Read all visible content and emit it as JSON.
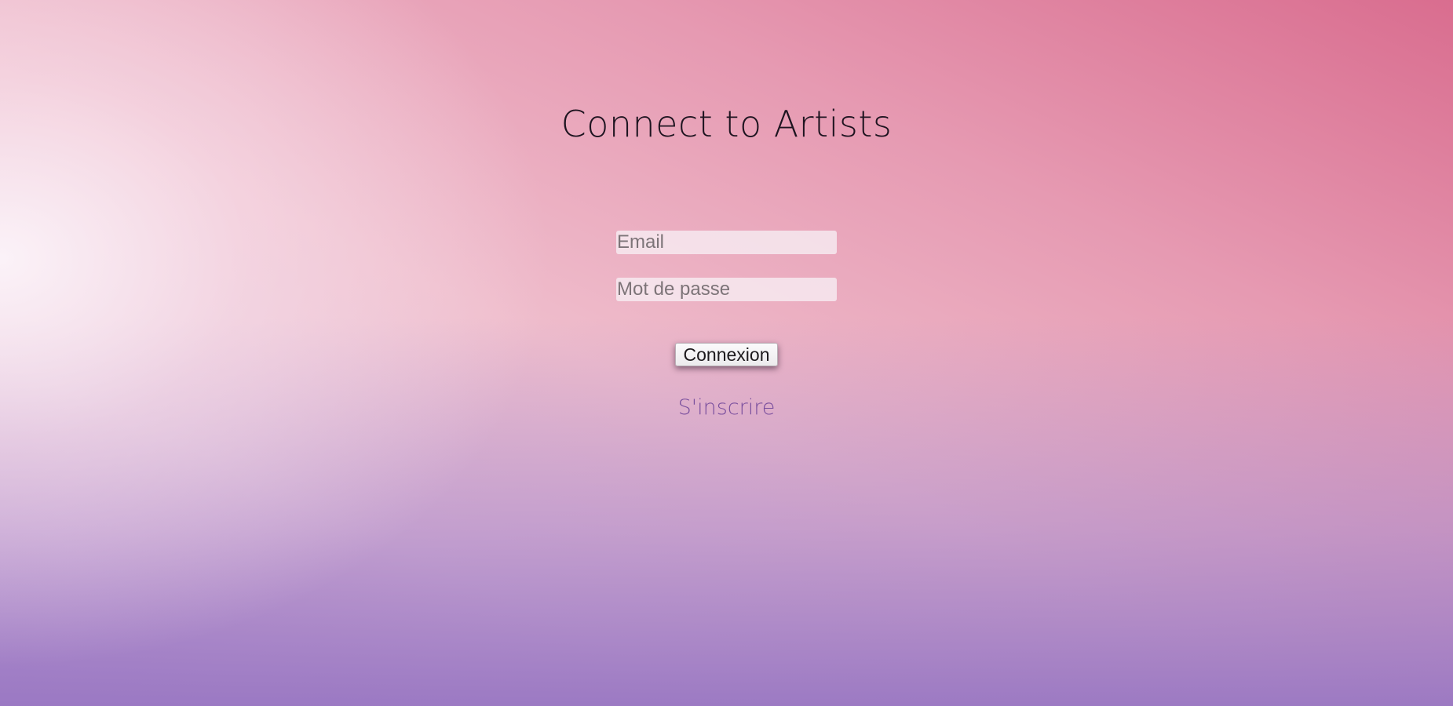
{
  "page": {
    "title": "Connect to Artists"
  },
  "login_form": {
    "email_placeholder": "Email",
    "email_value": "",
    "password_placeholder": "Mot de passe",
    "password_value": "",
    "submit_label": "Connexion",
    "signup_label": "S'inscrire"
  },
  "colors": {
    "gradient_top_right": "#d96d8f",
    "gradient_bottom": "#9876c2",
    "title_text": "#1e1420",
    "signup_link": "#7a4f9e"
  }
}
